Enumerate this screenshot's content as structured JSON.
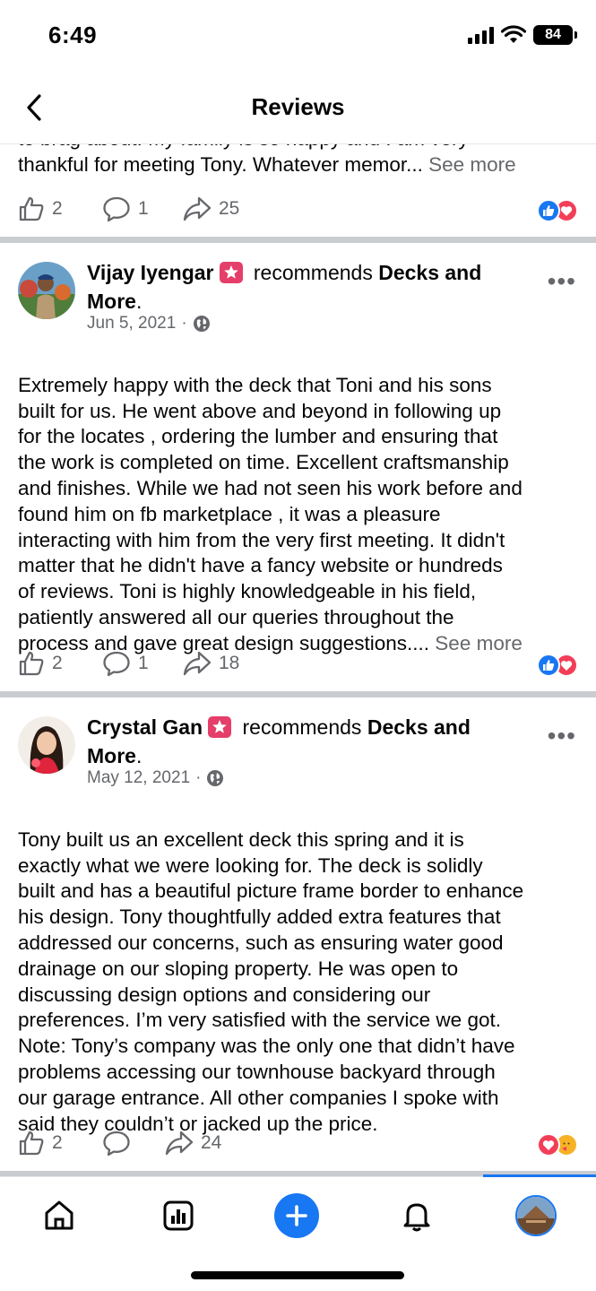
{
  "status": {
    "time": "6:49",
    "battery": "84"
  },
  "header": {
    "title": "Reviews"
  },
  "top_post": {
    "cut_text": "to brag about. My family is so happy and I am very",
    "text": "thankful for meeting Tony.  Whatever memor...",
    "see_more": "See more",
    "likes": "2",
    "comments": "1",
    "shares": "25"
  },
  "posts": [
    {
      "name": "Vijay Iyengar",
      "recommends": "recommends",
      "page_line1": "Decks and",
      "page_line2": "More",
      "date": "Jun 5, 2021",
      "text": "Extremely happy with the deck that Toni and his sons\nbuilt for us. He went above and beyond in following up\nfor the locates , ordering the lumber and ensuring that\nthe work is completed on time. Excellent craftsmanship\nand finishes. While we had not seen his work before and\nfound him on fb marketplace , it was a pleasure\ninteracting with him from the very first meeting. It didn't\nmatter that he didn't have a fancy website or hundreds\nof reviews. Toni is highly knowledgeable in his field,\npatiently answered all our queries throughout the",
      "last_line": "process and gave great design suggestions.... ",
      "see_more": "See more",
      "likes": "2",
      "comments": "1",
      "shares": "18"
    },
    {
      "name": "Crystal Gan",
      "recommends": "recommends",
      "page_line1": "Decks and",
      "page_line2": "More",
      "date": "May 12, 2021",
      "text": "Tony built us an excellent deck this spring and it is\nexactly what we were looking for. The deck is solidly\nbuilt and has a beautiful picture frame border to enhance\nhis design. Tony thoughtfully added extra features that\naddressed our concerns, such as ensuring water good\ndrainage on our sloping property. He was open to\ndiscussing design options and considering our\npreferences. I’m very satisfied with the service we got.\nNote: Tony’s company was the only one that didn’t have\nproblems accessing our townhouse backyard through\nour garage entrance. All other companies I spoke with\nsaid they couldn’t or jacked up the price.",
      "likes": "2",
      "comments": "",
      "shares": "24"
    }
  ],
  "colors": {
    "accent": "#1877f2",
    "love": "#f33e58",
    "secondary_text": "#65676b",
    "separator": "#c9ccd1"
  },
  "icons": [
    "back-chevron-icon",
    "like-icon",
    "comment-icon",
    "share-icon",
    "globe-icon",
    "home-icon",
    "dashboard-icon",
    "plus-icon",
    "bell-icon"
  ]
}
